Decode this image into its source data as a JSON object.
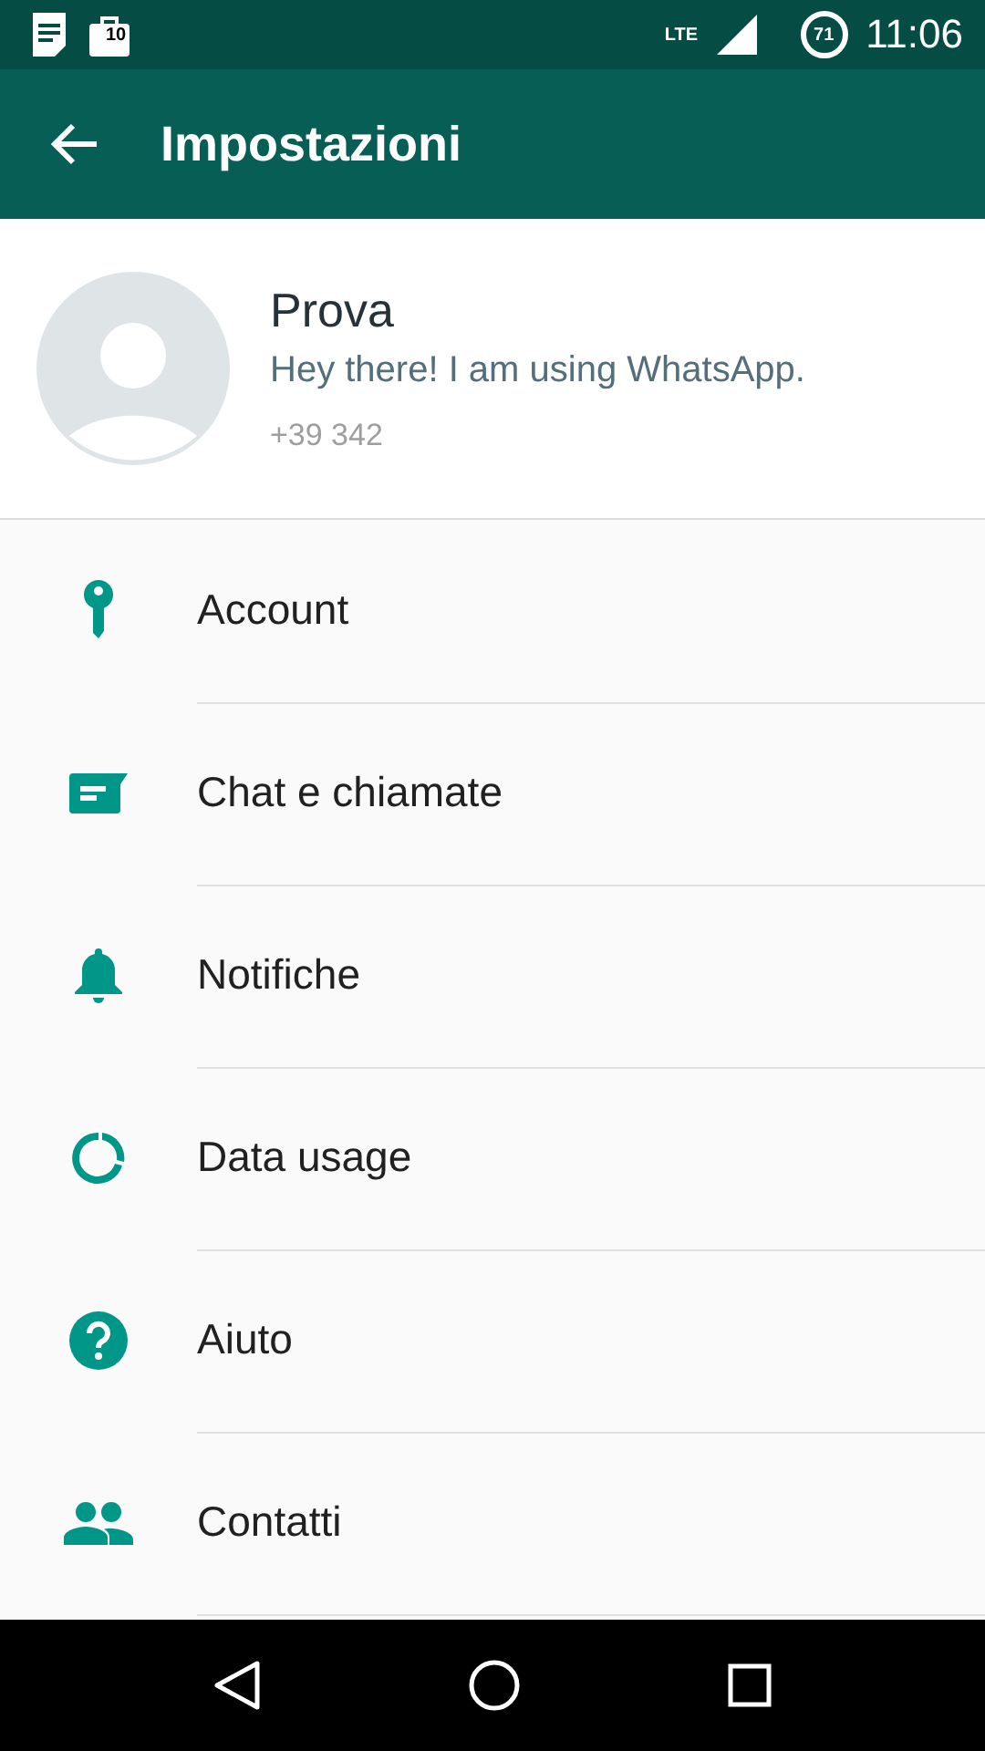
{
  "status_bar": {
    "notification_badge": "10",
    "network": "LTE",
    "battery": "71",
    "time": "11:06"
  },
  "toolbar": {
    "title": "Impostazioni"
  },
  "profile": {
    "name": "Prova",
    "status": "Hey there! I am using WhatsApp.",
    "phone": "+39 342"
  },
  "settings": [
    {
      "kind": "key",
      "label": "Account"
    },
    {
      "kind": "chat",
      "label": "Chat e chiamate"
    },
    {
      "kind": "bell",
      "label": "Notifiche"
    },
    {
      "kind": "data",
      "label": "Data usage"
    },
    {
      "kind": "help",
      "label": "Aiuto"
    },
    {
      "kind": "contacts",
      "label": "Contatti"
    }
  ]
}
